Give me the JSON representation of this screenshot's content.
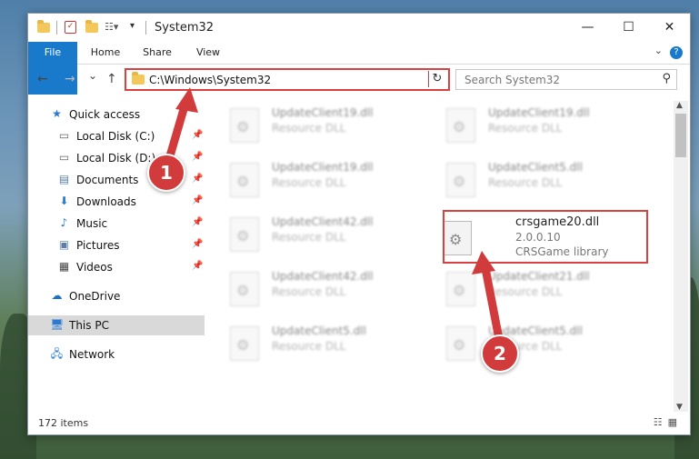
{
  "window": {
    "title": "System32",
    "controls": {
      "minimize": "—",
      "maximize": "☐",
      "close": "✕"
    }
  },
  "ribbon": {
    "tabs": [
      "File",
      "Home",
      "Share",
      "View"
    ],
    "help": "?"
  },
  "navigation": {
    "back_icon": "←",
    "forward_icon": "→",
    "recent_icon": "⌄",
    "up_icon": "↑",
    "address_path": "C:\\Windows\\System32",
    "search_placeholder": "Search System32"
  },
  "sidebar": {
    "items": [
      {
        "label": "Quick access",
        "icon": "star-icon"
      },
      {
        "label": "Local Disk (C:)",
        "icon": "drive-icon",
        "pinned": true
      },
      {
        "label": "Local Disk (D:)",
        "icon": "drive-icon",
        "pinned": true
      },
      {
        "label": "Documents",
        "icon": "documents-icon",
        "pinned": true
      },
      {
        "label": "Downloads",
        "icon": "download-icon",
        "pinned": true
      },
      {
        "label": "Music",
        "icon": "music-icon",
        "pinned": true
      },
      {
        "label": "Pictures",
        "icon": "pictures-icon",
        "pinned": true
      },
      {
        "label": "Videos",
        "icon": "videos-icon",
        "pinned": true
      },
      {
        "label": "OneDrive",
        "icon": "cloud-icon"
      },
      {
        "label": "This PC",
        "icon": "computer-icon",
        "selected": true
      },
      {
        "label": "Network",
        "icon": "network-icon"
      }
    ]
  },
  "files": [
    {
      "name": "UpdateClient19.dll",
      "type": "Resource DLL"
    },
    {
      "name": "UpdateClient19.dll",
      "type": "Resource DLL"
    },
    {
      "name": "UpdateClient19.dll",
      "type": "Resource DLL"
    },
    {
      "name": "UpdateClient5.dll",
      "type": "Resource DLL"
    },
    {
      "name": "UpdateClient42.dll",
      "type": "Resource DLL"
    },
    {
      "name": "crsgame20.dll",
      "version": "2.0.0.10",
      "type": "CRSGame library",
      "highlighted": true
    },
    {
      "name": "UpdateClient42.dll",
      "type": "Resource DLL"
    },
    {
      "name": "UpdateClient21.dll",
      "type": "Resource DLL"
    },
    {
      "name": "UpdateClient5.dll",
      "type": "Resource DLL"
    },
    {
      "name": "UpdateClient5.dll",
      "type": "Resource DLL"
    }
  ],
  "status": {
    "item_count": "172 items"
  },
  "annotations": {
    "step1": "1",
    "step2": "2",
    "color": "#d23b3b"
  }
}
